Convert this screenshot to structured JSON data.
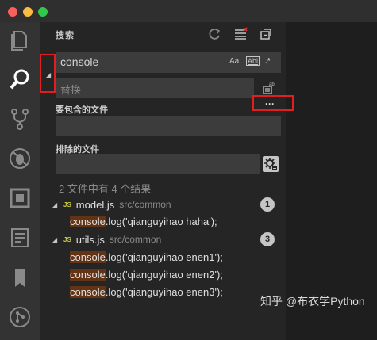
{
  "sidebar": {
    "title": "搜索"
  },
  "search": {
    "value": "console",
    "opt_case": "Aa",
    "opt_word": "Abl",
    "opt_regex": ".*"
  },
  "replace": {
    "placeholder": "替换"
  },
  "more": {
    "label": "···"
  },
  "include": {
    "label": "要包含的文件"
  },
  "exclude": {
    "label": "排除的文件"
  },
  "results": {
    "summary": "2 文件中有 4 个结果",
    "files": [
      {
        "badge": "JS",
        "name": "model.js",
        "path": "src/common",
        "count": "1",
        "matches": [
          {
            "hl": "console",
            "rest": ".log('qianguyihao haha');"
          }
        ]
      },
      {
        "badge": "JS",
        "name": "utils.js",
        "path": "src/common",
        "count": "3",
        "matches": [
          {
            "hl": "console",
            "rest": ".log('qianguyihao enen1');"
          },
          {
            "hl": "console",
            "rest": ".log('qianguyihao enen2');"
          },
          {
            "hl": "console",
            "rest": ".log('qianguyihao enen3');"
          }
        ]
      }
    ]
  },
  "watermark": "知乎 @布衣学Python",
  "colors": {
    "highlight": "#623315",
    "annotation": "#e02020"
  },
  "icons": {
    "activity": [
      "files-icon",
      "search-icon",
      "source-control-icon",
      "debug-icon",
      "extensions-icon",
      "explorer-panel-icon",
      "bookmark-icon",
      "git-icon"
    ],
    "header": [
      "refresh-icon",
      "clear-results-icon",
      "collapse-all-icon"
    ]
  }
}
